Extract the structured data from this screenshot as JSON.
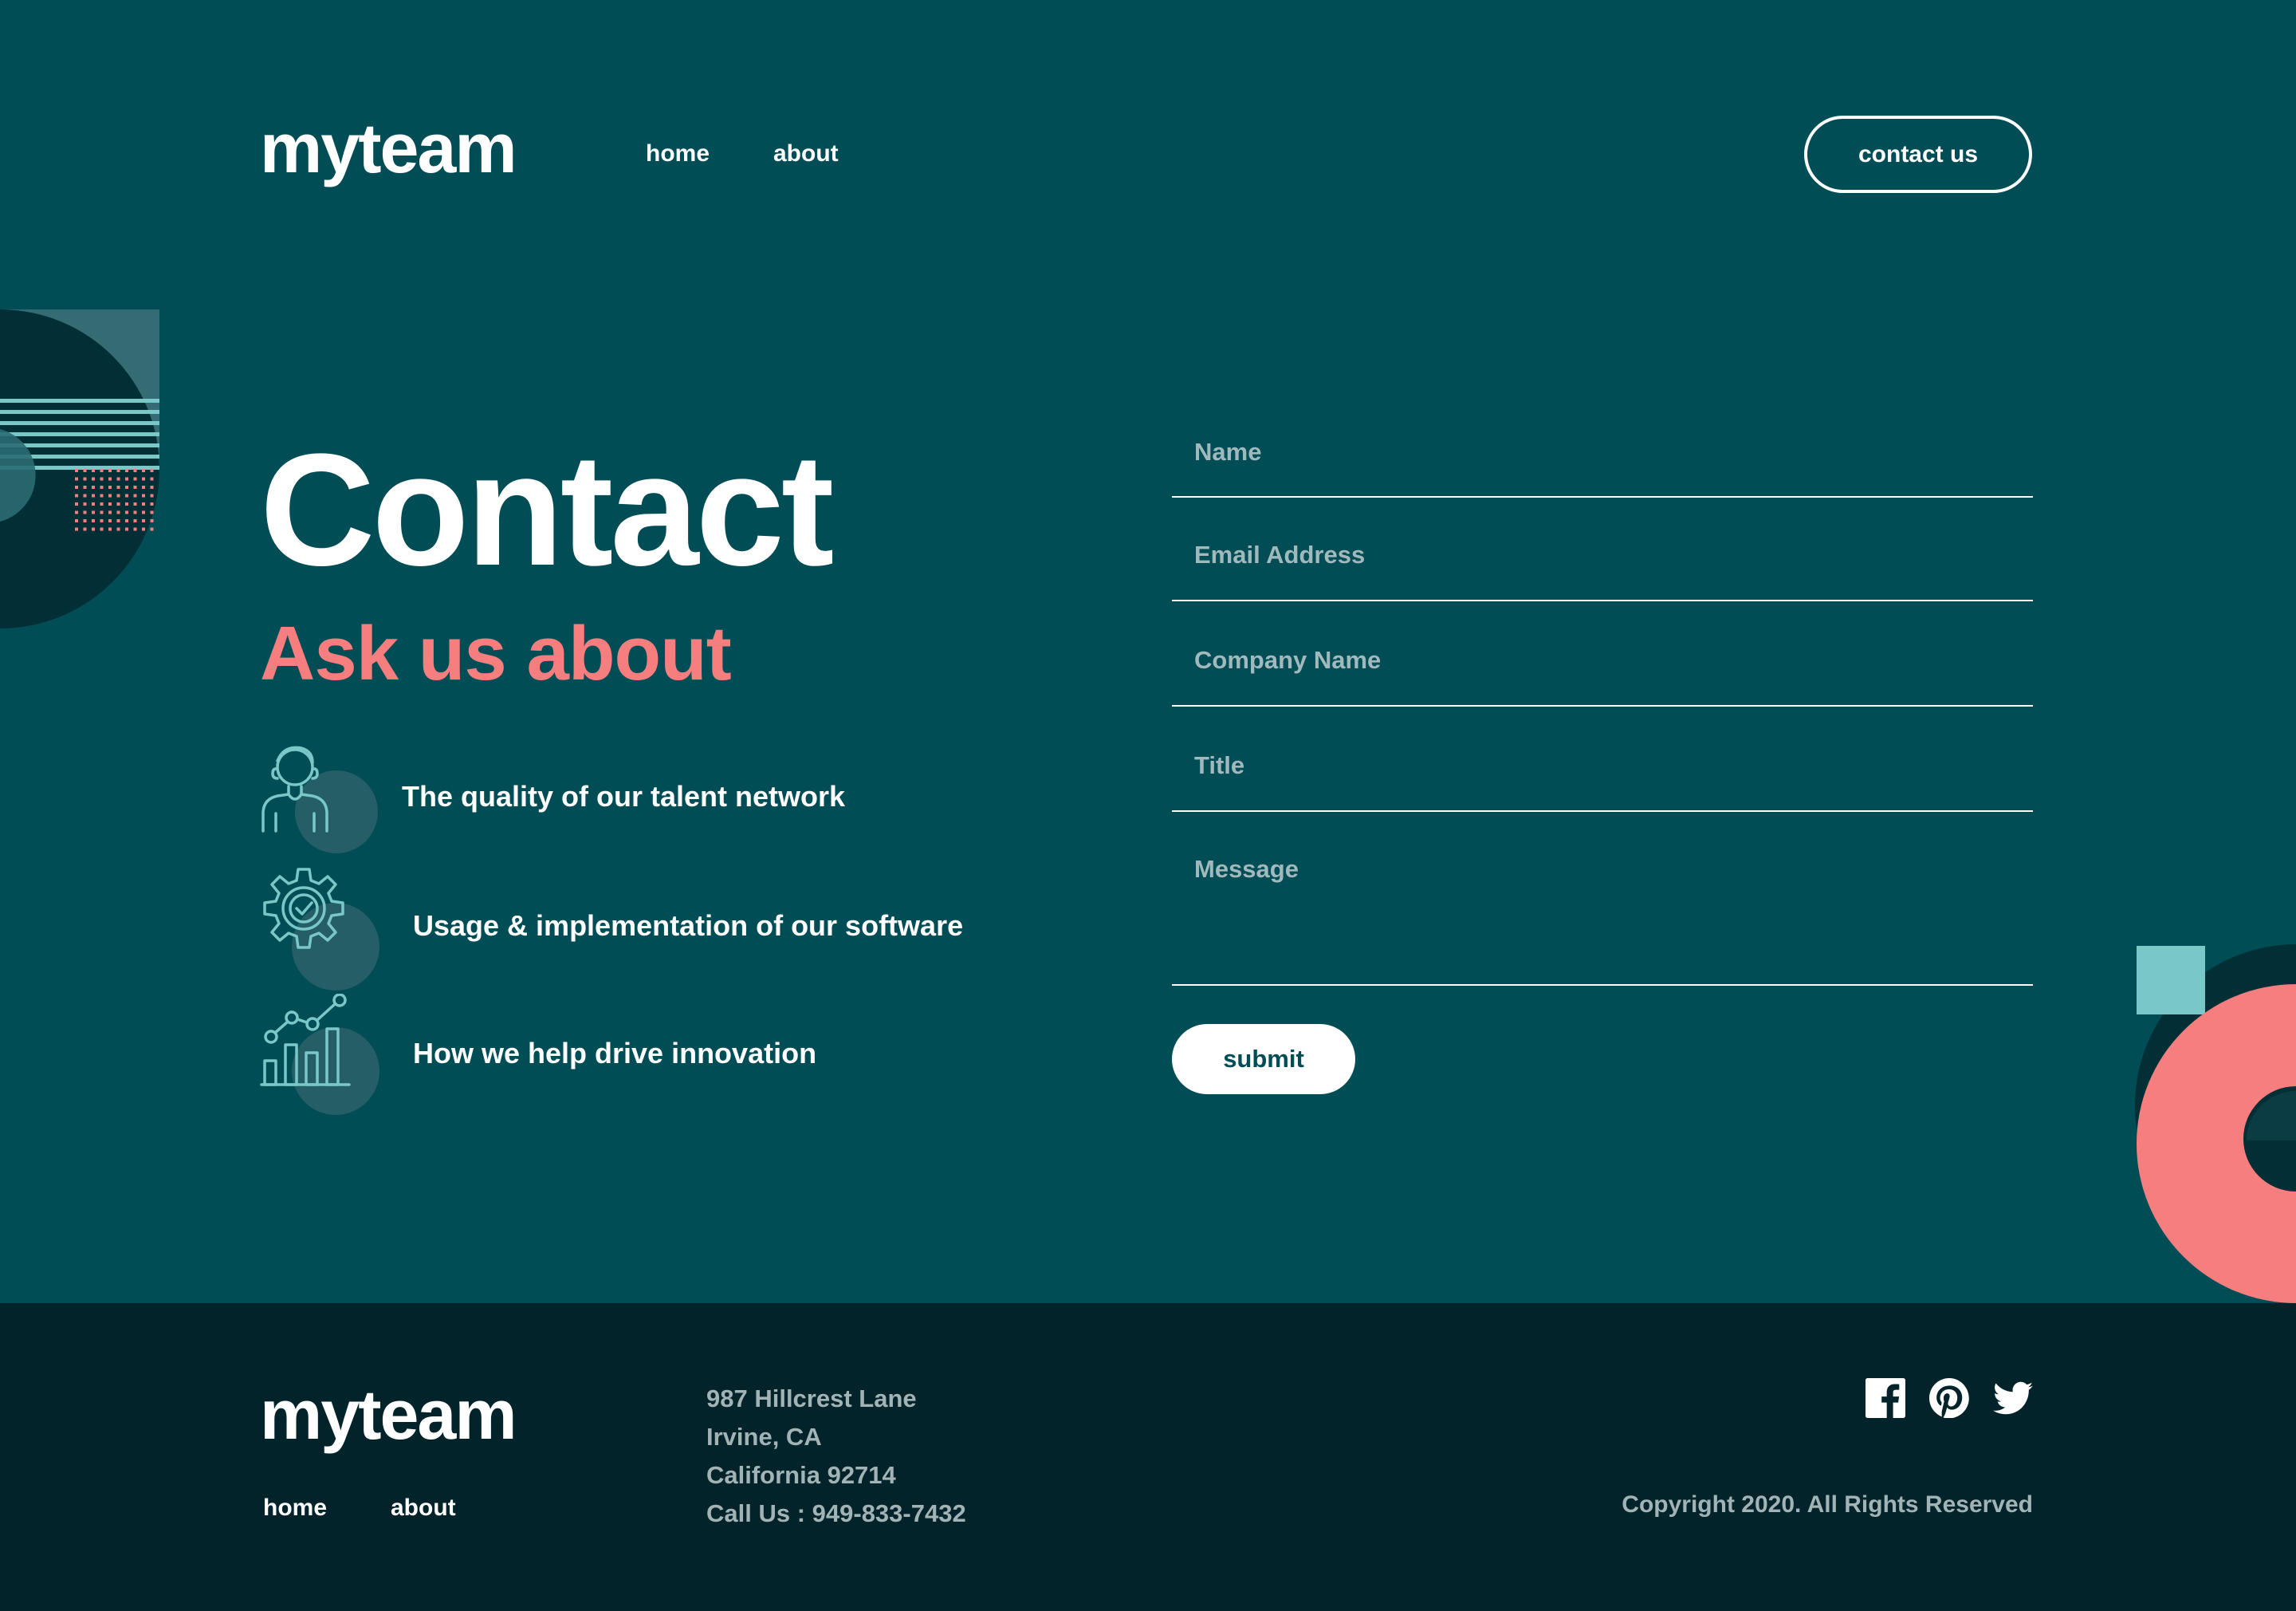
{
  "colors": {
    "background": "#004d56",
    "footer_background": "#012329",
    "accent_coral": "#f67e7e",
    "accent_teal": "#79c8c7",
    "text": "#ffffff",
    "muted_text": "#a2b3b6"
  },
  "header": {
    "logo": "myteam",
    "nav": [
      {
        "label": "home"
      },
      {
        "label": "about"
      }
    ],
    "cta_label": "contact us"
  },
  "hero": {
    "title": "Contact",
    "subtitle": "Ask us about",
    "topics": [
      {
        "icon": "person-icon",
        "label": "The quality of our talent network"
      },
      {
        "icon": "gear-check-icon",
        "label": "Usage & implementation of our software"
      },
      {
        "icon": "chart-icon",
        "label": "How we help drive innovation"
      }
    ]
  },
  "form": {
    "name_placeholder": "Name",
    "email_placeholder": "Email Address",
    "company_placeholder": "Company Name",
    "title_placeholder": "Title",
    "message_placeholder": "Message",
    "submit_label": "submit"
  },
  "footer": {
    "logo": "myteam",
    "nav": [
      {
        "label": "home"
      },
      {
        "label": "about"
      }
    ],
    "address": [
      "987 Hillcrest Lane",
      "Irvine, CA",
      "California 92714",
      "Call Us : 949-833-7432"
    ],
    "social": [
      "facebook-icon",
      "pinterest-icon",
      "twitter-icon"
    ],
    "copyright": "Copyright 2020. All Rights Reserved"
  }
}
